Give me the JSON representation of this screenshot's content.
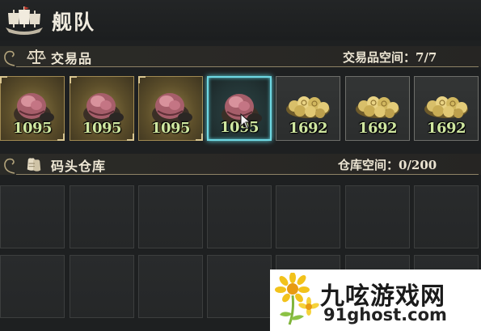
{
  "window": {
    "title": "舰队"
  },
  "trade_section": {
    "label": "交易品",
    "capacity_label": "交易品空间：",
    "capacity_value": "7/7",
    "items": [
      {
        "type": "silk-bale",
        "quantity": "1095",
        "selected": false
      },
      {
        "type": "silk-bale",
        "quantity": "1095",
        "selected": false
      },
      {
        "type": "silk-bale",
        "quantity": "1095",
        "selected": false
      },
      {
        "type": "silk-bale",
        "quantity": "1095",
        "selected": true
      },
      {
        "type": "coin-pile",
        "quantity": "1692",
        "selected": false
      },
      {
        "type": "coin-pile",
        "quantity": "1692",
        "selected": false
      },
      {
        "type": "coin-pile",
        "quantity": "1692",
        "selected": false
      }
    ]
  },
  "warehouse_section": {
    "label": "码头仓库",
    "capacity_label": "仓库空间：",
    "capacity_value": "0/200"
  },
  "watermark": {
    "brand": "九呟游戏网",
    "url": "91ghost.com"
  },
  "colors": {
    "background": "#1e2021",
    "trade_slot_gold": "#a18a52",
    "selection_cyan": "#6fd8e3",
    "quantity_green": "#cfe7a0"
  },
  "icons": [
    "sailing-ship-icon",
    "scales-icon",
    "warehouse-sacks-icon",
    "silk-bale-icon",
    "coin-pile-icon",
    "mouse-cursor-icon",
    "chrysanthemum-logo-icon"
  ]
}
